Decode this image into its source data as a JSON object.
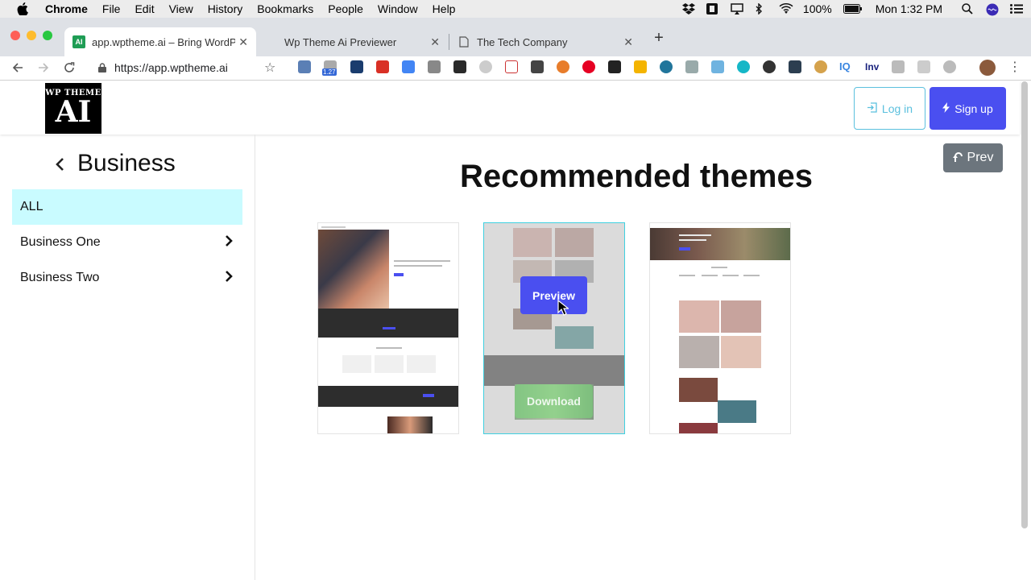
{
  "menubar": {
    "app_name": "Chrome",
    "items": [
      "File",
      "Edit",
      "View",
      "History",
      "Bookmarks",
      "People",
      "Window",
      "Help"
    ],
    "battery": "100%",
    "clock": "Mon 1:32 PM"
  },
  "tabs": [
    {
      "title": "app.wptheme.ai – Bring WordP",
      "favicon": "AI",
      "favicon_color": "#1f9d55"
    },
    {
      "title": "Wp Theme Ai Previewer"
    },
    {
      "title": "The Tech Company"
    }
  ],
  "toolbar": {
    "url": "https://app.wptheme.ai",
    "extension_badge": "1.27",
    "ext_text_1": "Inv",
    "ext_text_2": "IQ"
  },
  "site": {
    "logo_top": "WP THEME",
    "logo_main": "AI",
    "login_label": "Log in",
    "signup_label": "Sign up",
    "prev_label": "Prev",
    "accent_color": "#4a4ff0",
    "info_color": "#5bc0de"
  },
  "sidebar": {
    "title": "Business",
    "items": [
      {
        "label": "ALL"
      },
      {
        "label": "Business One"
      },
      {
        "label": "Business Two"
      }
    ]
  },
  "main": {
    "title": "Recommended themes",
    "cards": [
      {
        "name": "theme-1"
      },
      {
        "name": "theme-2",
        "preview_label": "Preview",
        "download_label": "Download"
      },
      {
        "name": "theme-3"
      }
    ]
  }
}
